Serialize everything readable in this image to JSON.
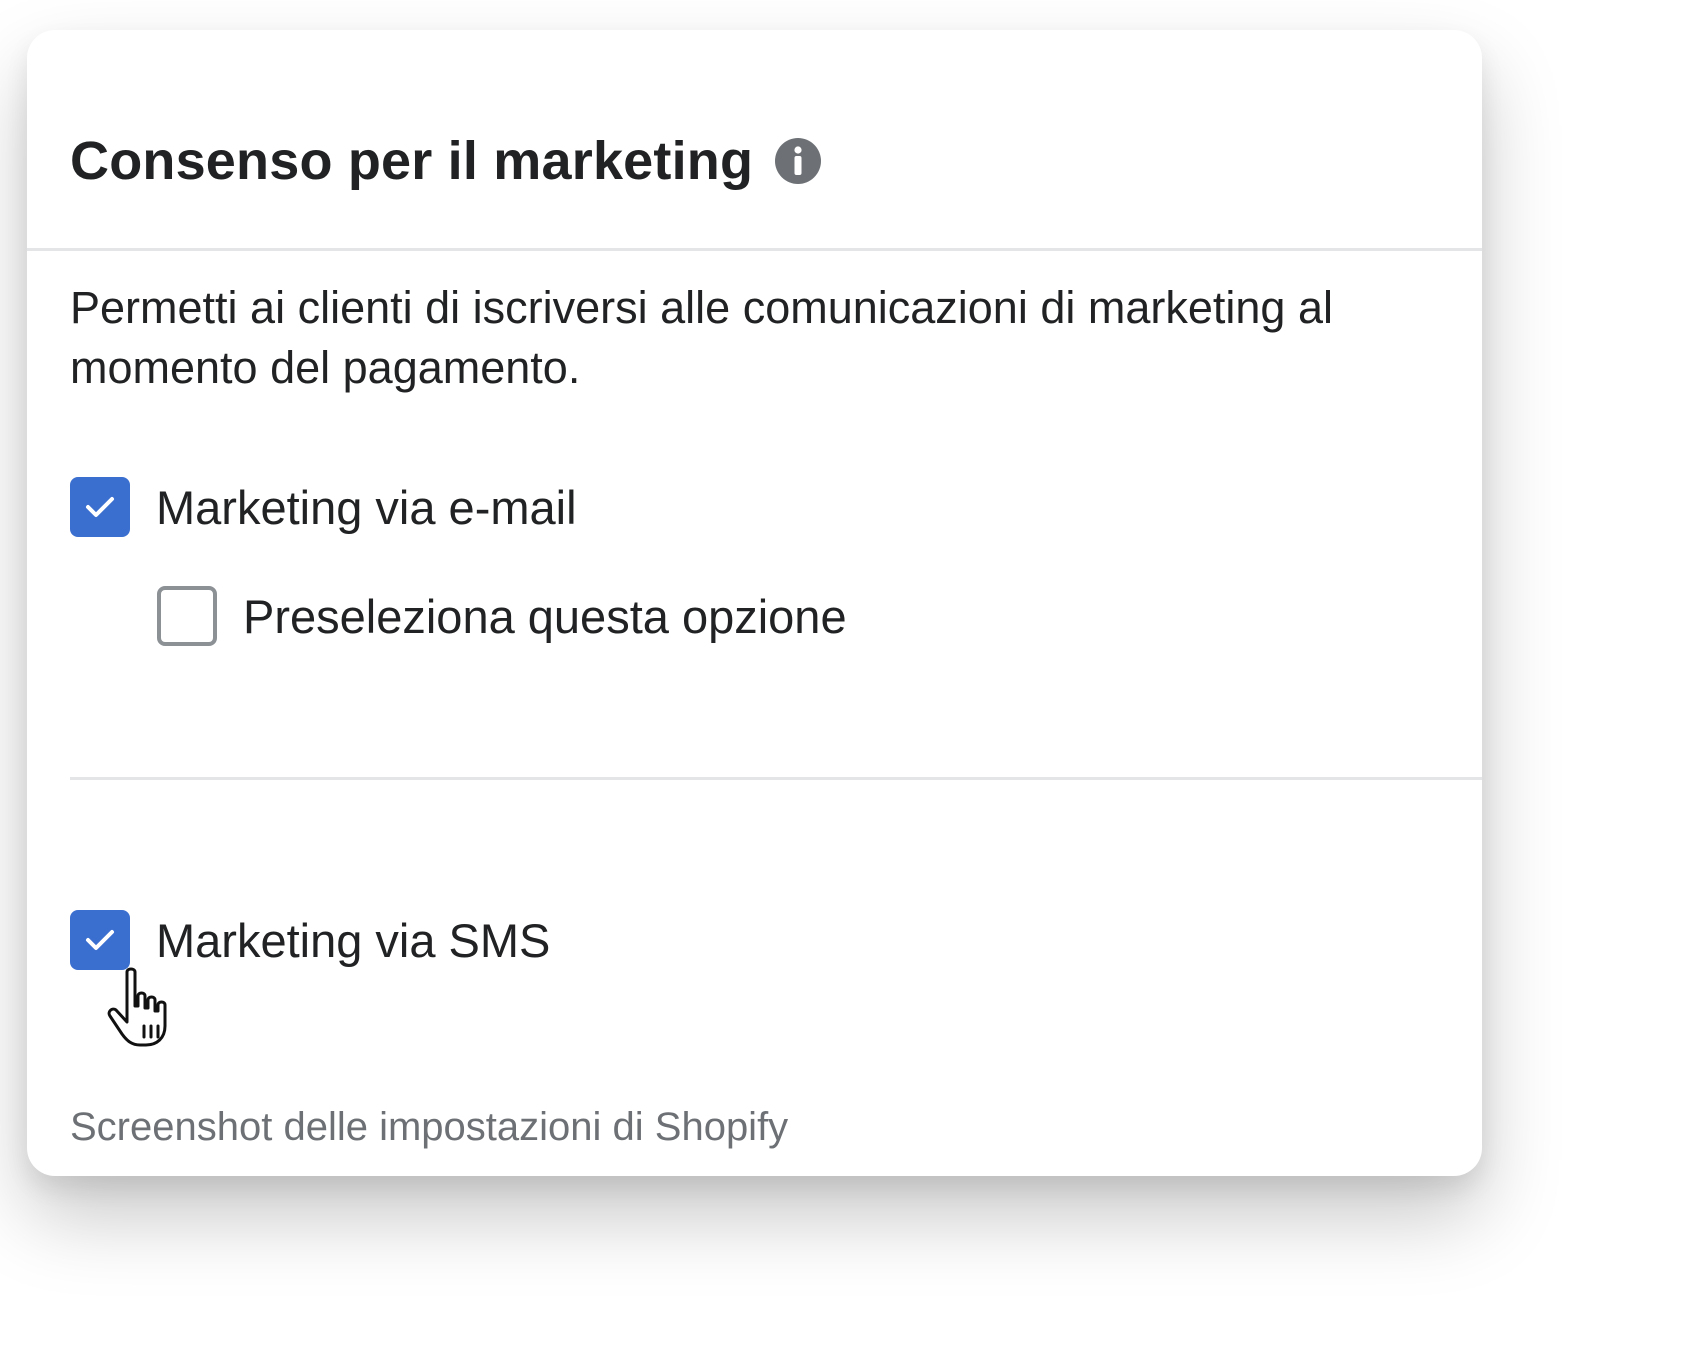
{
  "card": {
    "title": "Consenso per il marketing",
    "title_icon": "info-icon",
    "description": "Permetti ai clienti di iscriversi alle comunicazioni di marketing al momento del pagamento.",
    "options": {
      "email": {
        "label": "Marketing via e-mail",
        "checked": true
      },
      "preselect": {
        "label": "Preseleziona questa opzione",
        "checked": false
      },
      "sms": {
        "label": "Marketing via SMS",
        "checked": true
      }
    },
    "caption": "Screenshot delle impostazioni di Shopify"
  },
  "colors": {
    "accent": "#3b6fcf",
    "text": "#202223",
    "muted": "#6d7175",
    "border": "#e3e5e7",
    "checkbox_border": "#8c9196"
  },
  "cursor_icon": "pointer-hand-icon"
}
